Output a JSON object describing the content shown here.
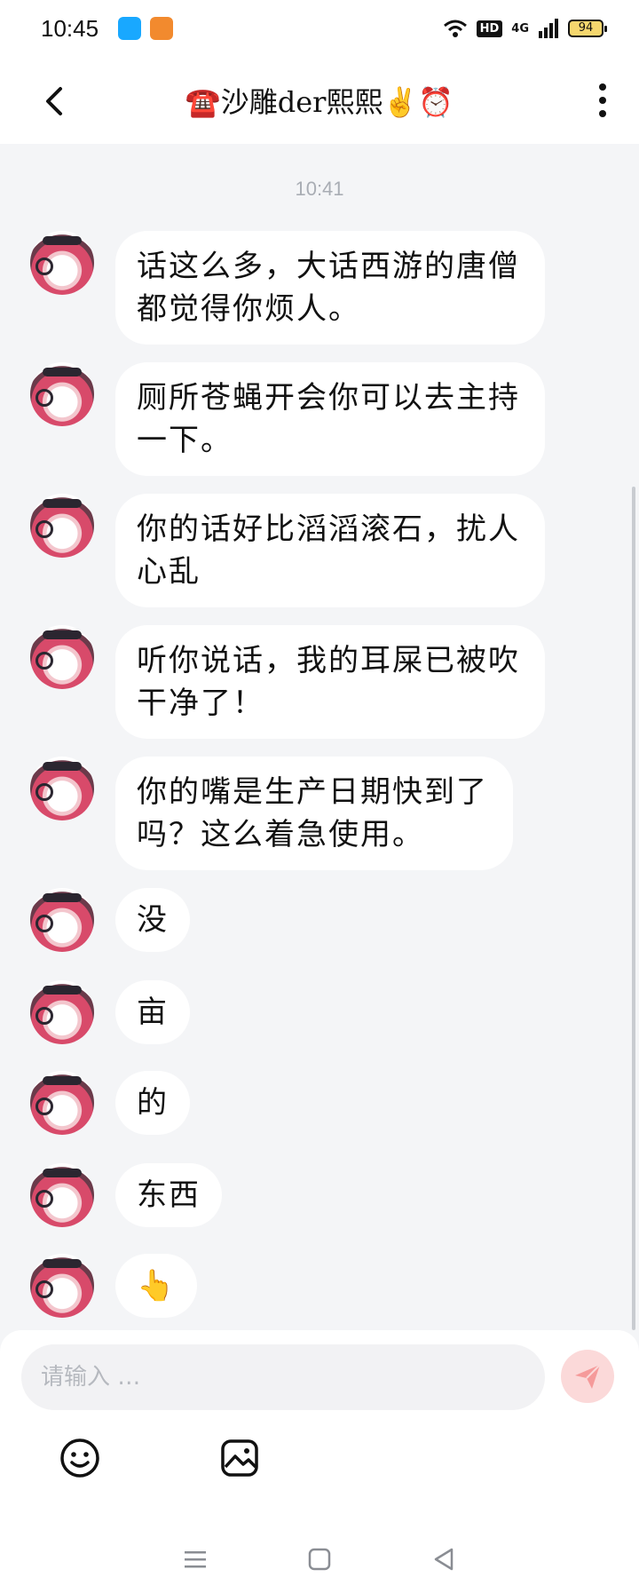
{
  "status_bar": {
    "time": "10:45",
    "hd_label": "HD",
    "network_label": "4G",
    "battery_level": "94"
  },
  "header": {
    "title": "☎️沙雕der熙熙✌️⏰"
  },
  "chat": {
    "timestamp": "10:41",
    "messages": [
      {
        "text": "话这么多，大话西游的唐僧都觉得你烦人。"
      },
      {
        "text": "厕所苍蝇开会你可以去主持一下。"
      },
      {
        "text": "你的话好比滔滔滚石，扰人心乱"
      },
      {
        "text": "听你说话，我的耳屎已被吹干净了！"
      },
      {
        "text": "你的嘴是生产日期快到了吗？这么着急使用。"
      },
      {
        "text": "没"
      },
      {
        "text": "亩"
      },
      {
        "text": "的"
      },
      {
        "text": "东西"
      },
      {
        "text": "👆"
      }
    ]
  },
  "input": {
    "placeholder": "请输入 …"
  },
  "colors": {
    "background": "#f4f5f7",
    "bubble": "#ffffff",
    "send_button": "#fbd9d9",
    "send_icon": "#f59a9a",
    "timestamp": "#a9adb4"
  },
  "icons": {
    "back": "chevron-left-icon",
    "more": "more-vertical-icon",
    "send": "paper-plane-icon",
    "emoji": "smiley-icon",
    "image": "image-icon",
    "nav_menu": "menu-icon",
    "nav_home": "square-icon",
    "nav_back": "triangle-back-icon"
  }
}
